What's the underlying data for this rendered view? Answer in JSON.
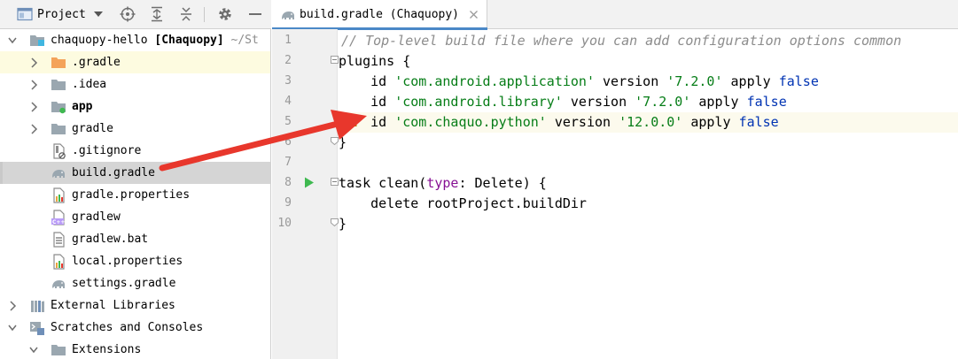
{
  "project_panel": {
    "view_selector_label": "Project",
    "tree": [
      {
        "label": "chaquopy-hello",
        "suffix": "[Chaquopy]",
        "path": "~/St",
        "icon": "module-folder-icon"
      },
      {
        "label": ".gradle",
        "icon": "folder-orange-icon"
      },
      {
        "label": ".idea",
        "icon": "folder-icon"
      },
      {
        "label": "app",
        "icon": "module-folder-icon"
      },
      {
        "label": "gradle",
        "icon": "folder-icon"
      },
      {
        "label": ".gitignore",
        "icon": "ignored-file-icon"
      },
      {
        "label": "build.gradle",
        "icon": "gradle-elephant-icon"
      },
      {
        "label": "gradle.properties",
        "icon": "properties-file-icon"
      },
      {
        "label": "gradlew",
        "icon": "cpp-file-icon"
      },
      {
        "label": "gradlew.bat",
        "icon": "text-file-icon"
      },
      {
        "label": "local.properties",
        "icon": "properties-file-icon"
      },
      {
        "label": "settings.gradle",
        "icon": "gradle-elephant-icon"
      },
      {
        "label": "External Libraries",
        "icon": "libraries-icon"
      },
      {
        "label": "Scratches and Consoles",
        "icon": "scratches-icon"
      },
      {
        "label": "Extensions",
        "icon": "folder-icon"
      }
    ]
  },
  "editor": {
    "tab_label": "build.gradle (Chaquopy)",
    "line_numbers": [
      "1",
      "2",
      "3",
      "4",
      "5",
      "6",
      "7",
      "8",
      "9",
      "10"
    ],
    "code": {
      "l1_comment": "// Top-level build file where you can add configuration options common",
      "l2_plugins": "plugins {",
      "l3_id": "    id ",
      "l3_str": "'com.android.application'",
      "l3_version": " version ",
      "l3_ver": "'7.2.0'",
      "l3_apply": " apply ",
      "l3_false": "false",
      "l4_id": "    id ",
      "l4_str": "'com.android.library'",
      "l4_version": " version ",
      "l4_ver": "'7.2.0'",
      "l4_apply": " apply ",
      "l4_false": "false",
      "l5_id": "    id ",
      "l5_str": "'com.chaquo.python'",
      "l5_version": " version ",
      "l5_ver": "'12.0.0'",
      "l5_apply": " apply ",
      "l5_false": "false",
      "l6_close": "}",
      "l8_task": "task clean(",
      "l8_type": "type",
      "l8_rest": ": Delete) {",
      "l9_delete": "    delete rootProject.buildDir",
      "l10_close": "}"
    }
  },
  "colors": {
    "keyword": "#0033b3",
    "string": "#067d17",
    "comment": "#8c8c8c",
    "named_arg": "#871094",
    "arrow": "#e8372c",
    "selection": "#d5d5d5",
    "highlight": "#fdfbe0"
  }
}
